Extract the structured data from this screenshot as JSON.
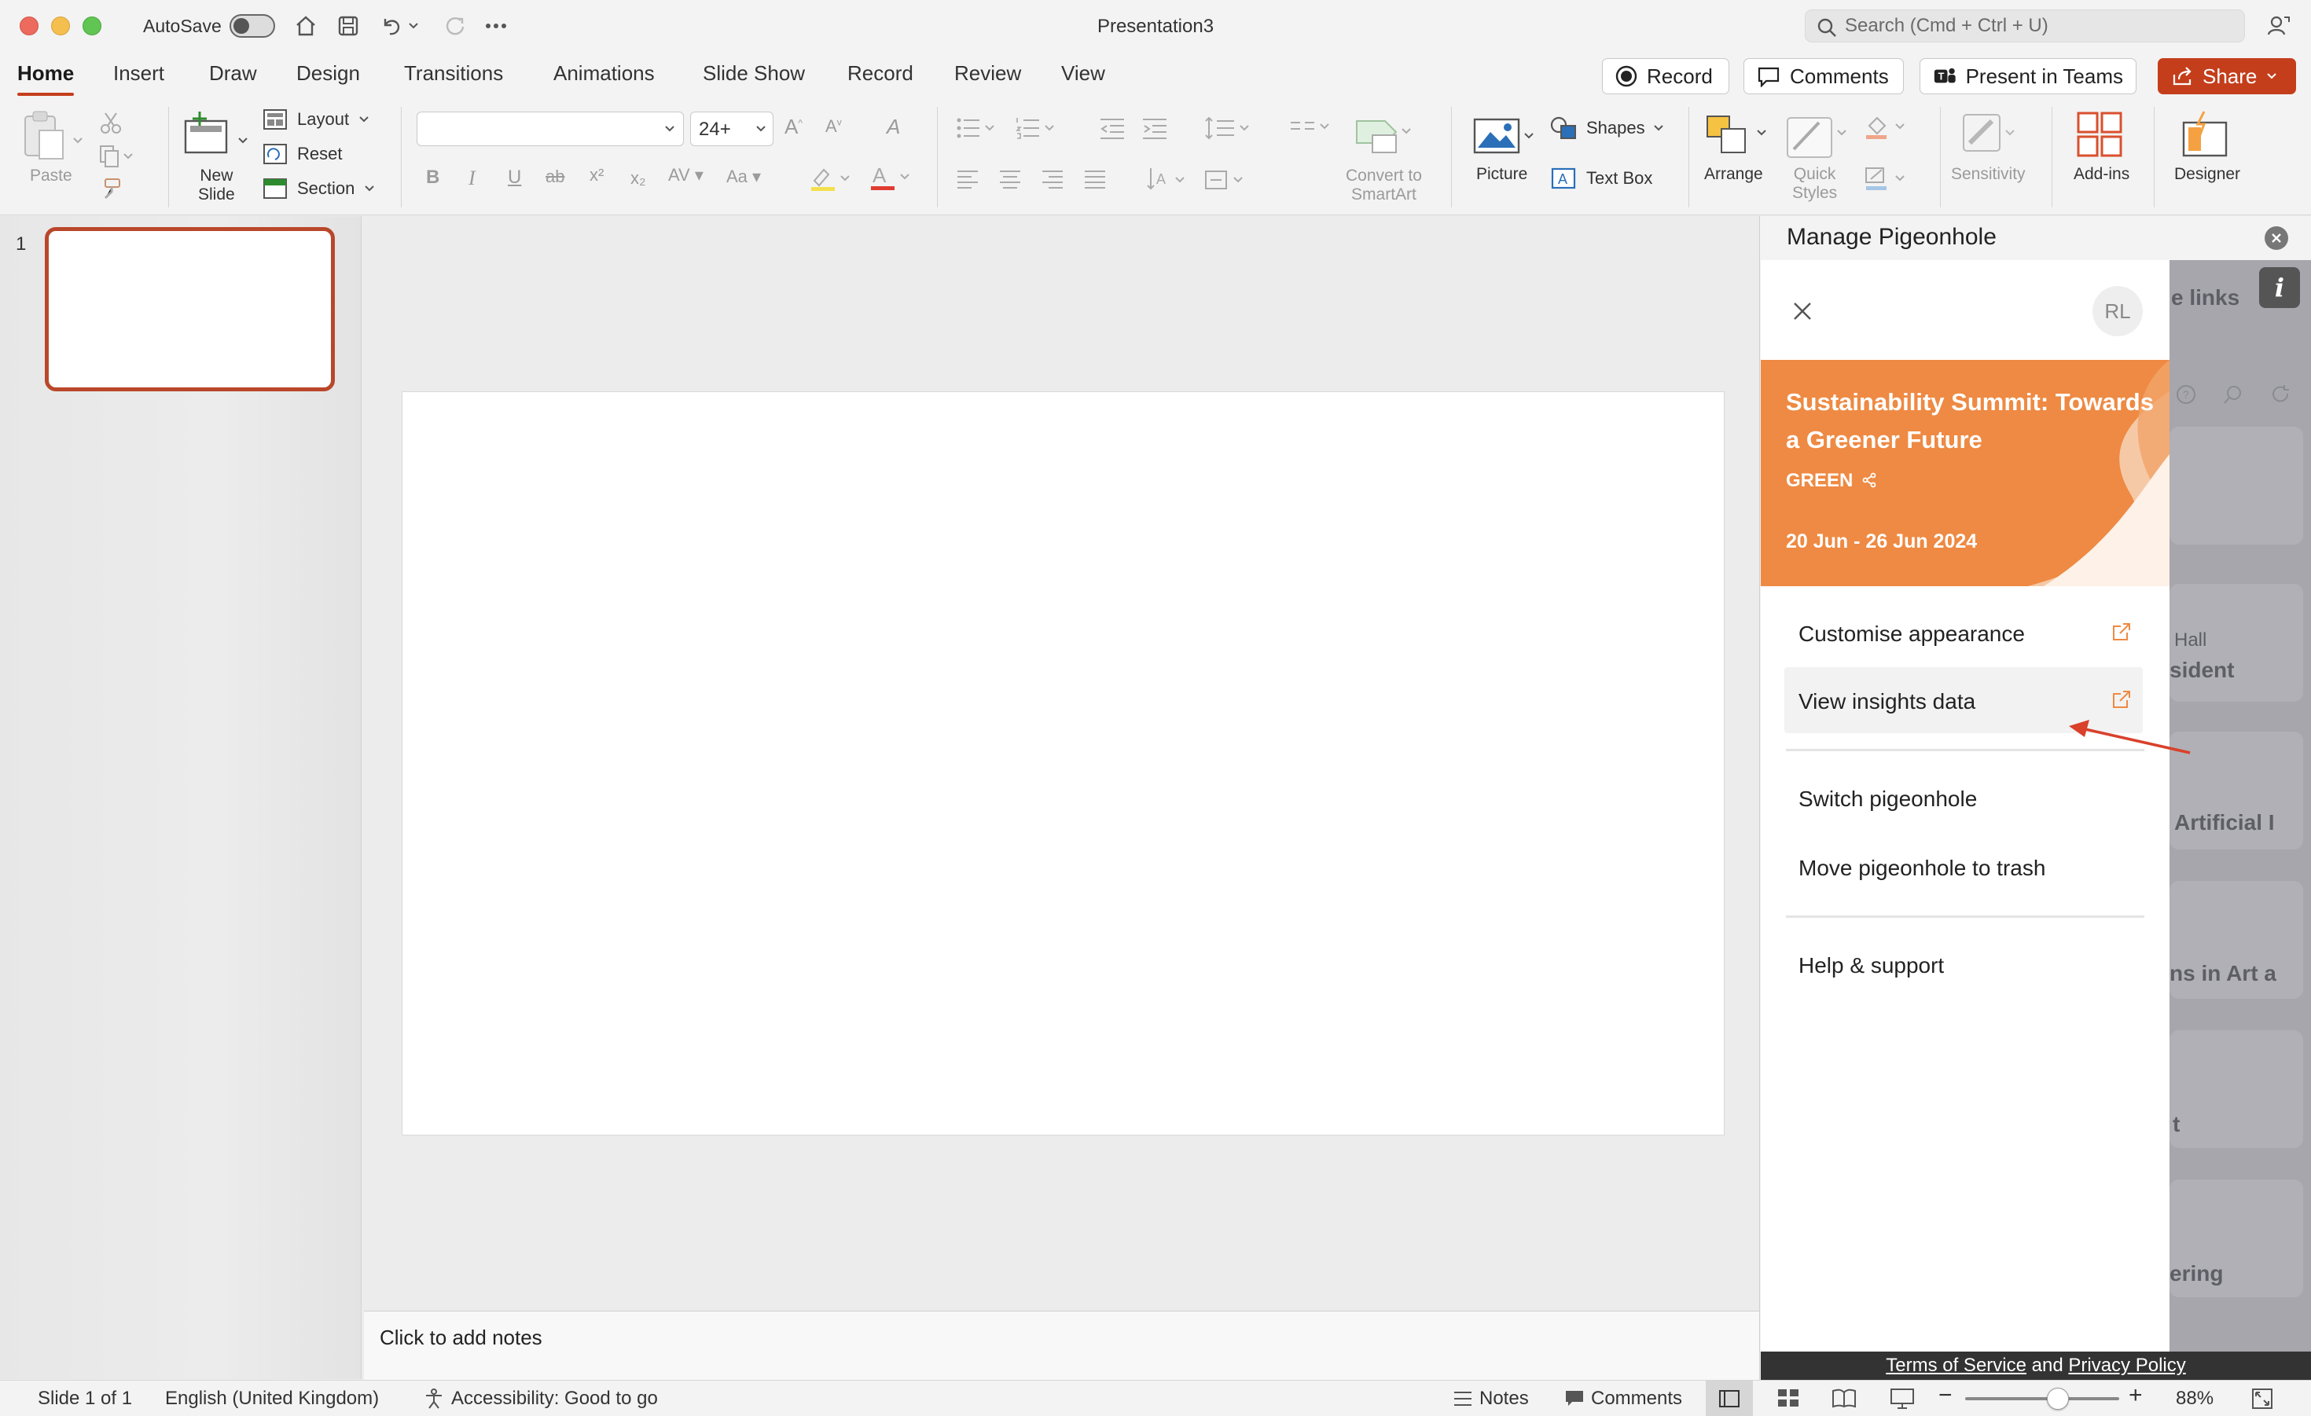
{
  "titlebar": {
    "autosave_label": "AutoSave",
    "doc_title": "Presentation3",
    "search_placeholder": "Search (Cmd + Ctrl + U)"
  },
  "tabs": [
    {
      "label": "Home",
      "active": true
    },
    {
      "label": "Insert"
    },
    {
      "label": "Draw"
    },
    {
      "label": "Design"
    },
    {
      "label": "Transitions"
    },
    {
      "label": "Animations"
    },
    {
      "label": "Slide Show"
    },
    {
      "label": "Record"
    },
    {
      "label": "Review"
    },
    {
      "label": "View"
    }
  ],
  "actions": {
    "record": "Record",
    "comments": "Comments",
    "present_teams": "Present in Teams",
    "share": "Share"
  },
  "ribbon": {
    "paste": "Paste",
    "new_slide": "New\nSlide",
    "layout": "Layout",
    "reset": "Reset",
    "section": "Section",
    "font_size": "24+",
    "convert_smartart": "Convert to\nSmartArt",
    "picture": "Picture",
    "shapes": "Shapes",
    "text_box": "Text Box",
    "arrange": "Arrange",
    "quick_styles": "Quick\nStyles",
    "sensitivity": "Sensitivity",
    "add_ins": "Add-ins",
    "designer": "Designer"
  },
  "thumbnails": {
    "slide_number": "1"
  },
  "notes": {
    "placeholder": "Click to add notes"
  },
  "panel": {
    "title": "Manage Pigeonhole",
    "avatar_initials": "RL",
    "event": {
      "title": "Sustainability Summit: Towards a Greener Future",
      "code": "GREEN",
      "dates": "20 Jun - 26 Jun 2024"
    },
    "menu": {
      "customise": "Customise appearance",
      "insights": "View insights data",
      "switch": "Switch pigeonhole",
      "trash": "Move pigeonhole to trash",
      "help": "Help & support"
    },
    "background_fragments": {
      "links": "e links",
      "hall": "Hall",
      "president": "sident",
      "artificial": "Artificial I",
      "art": "ns in Art a",
      "t": "t",
      "ering": "ering"
    },
    "legal": {
      "terms": "Terms of Service",
      "and": "and",
      "privacy": "Privacy Policy"
    }
  },
  "status": {
    "slide_info": "Slide 1 of 1",
    "language": "English (United Kingdom)",
    "accessibility": "Accessibility: Good to go",
    "notes": "Notes",
    "comments": "Comments",
    "zoom_percent": "88%",
    "zoom_level": 0.6
  },
  "colors": {
    "accent": "#c43e1c",
    "banner": "#ee8a43",
    "arrow": "#d9412b"
  }
}
